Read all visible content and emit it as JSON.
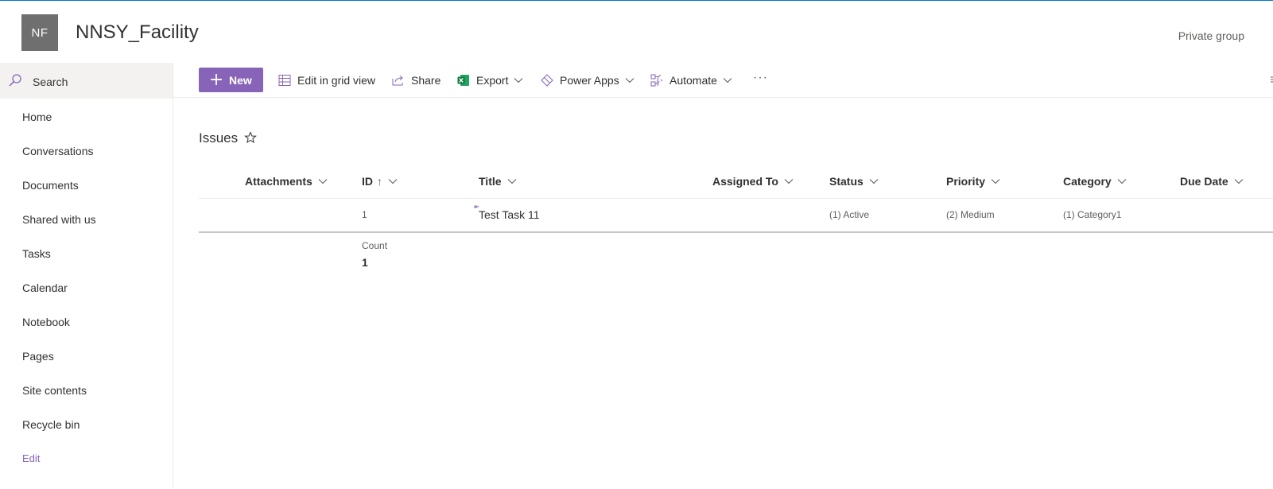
{
  "site": {
    "logo_initials": "NF",
    "title": "NNSY_Facility",
    "privacy_label": "Private group"
  },
  "search": {
    "label": "Search"
  },
  "nav": {
    "items": [
      {
        "label": "Home"
      },
      {
        "label": "Conversations"
      },
      {
        "label": "Documents"
      },
      {
        "label": "Shared with us"
      },
      {
        "label": "Tasks"
      },
      {
        "label": "Calendar"
      },
      {
        "label": "Notebook"
      },
      {
        "label": "Pages"
      },
      {
        "label": "Site contents"
      },
      {
        "label": "Recycle bin"
      }
    ],
    "edit_label": "Edit"
  },
  "toolbar": {
    "new_label": "New",
    "edit_grid_label": "Edit in grid view",
    "share_label": "Share",
    "export_label": "Export",
    "power_apps_label": "Power Apps",
    "automate_label": "Automate",
    "more_label": "···"
  },
  "list": {
    "title": "Issues",
    "columns": {
      "attachments": "Attachments",
      "id": "ID",
      "id_sort": "↑",
      "title": "Title",
      "assigned_to": "Assigned To",
      "status": "Status",
      "priority": "Priority",
      "category": "Category",
      "due_date": "Due Date"
    },
    "rows": [
      {
        "id": "1",
        "title": "Test Task 11",
        "assigned_to": "",
        "status": "(1) Active",
        "priority": "(2) Medium",
        "category": "(1) Category1",
        "due_date": ""
      }
    ],
    "count_label": "Count",
    "count_value": "1"
  },
  "colors": {
    "accent": "#8764b8",
    "top_border": "#0078d4",
    "logo_bg": "#6f6f6f",
    "excel_green": "#107c41"
  }
}
